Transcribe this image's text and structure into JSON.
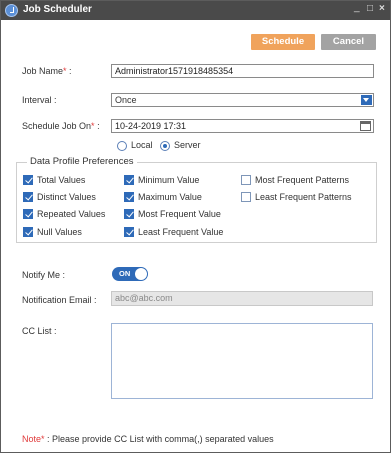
{
  "window": {
    "title": "Job Scheduler",
    "minimize": "_",
    "maximize": "□",
    "close": "×"
  },
  "actions": {
    "schedule_label": "Schedule",
    "cancel_label": "Cancel"
  },
  "form": {
    "job_name_label": "Job Name",
    "job_name_suffix": " :",
    "job_name_value": "Administrator1571918485354",
    "interval_label": "Interval :",
    "interval_value": "Once",
    "schedule_on_label": "Schedule Job On",
    "schedule_on_suffix": " :",
    "schedule_on_value": "10-24-2019 17:31",
    "location_options": [
      {
        "label": "Local",
        "checked": false
      },
      {
        "label": "Server",
        "checked": true
      }
    ]
  },
  "profile": {
    "legend": "Data Profile Preferences",
    "options": [
      {
        "label": "Total Values",
        "checked": true
      },
      {
        "label": "Minimum Value",
        "checked": true
      },
      {
        "label": "Most Frequent Patterns",
        "checked": false
      },
      {
        "label": "Distinct Values",
        "checked": true
      },
      {
        "label": "Maximum Value",
        "checked": true
      },
      {
        "label": "Least Frequent Patterns",
        "checked": false
      },
      {
        "label": "Repeated Values",
        "checked": true
      },
      {
        "label": "Most Frequent Value",
        "checked": true
      },
      {
        "label": "Null Values",
        "checked": true
      },
      {
        "label": "Least Frequent Value",
        "checked": true
      }
    ]
  },
  "notify": {
    "label": "Notify Me :",
    "toggle_text": "ON",
    "email_label": "Notification Email :",
    "email_value": "abc@abc.com",
    "cc_label": "CC List :"
  },
  "footer": {
    "note_label": "Note",
    "note_text": " : Please provide CC List with comma(,) separated values"
  },
  "asterisk": "*",
  "colors": {
    "titlebar": "#4a4a4a",
    "primary_button": "#f0a35c",
    "secondary_button": "#a3a3a3",
    "accent": "#2e6ab8",
    "required": "#e03a3a"
  }
}
